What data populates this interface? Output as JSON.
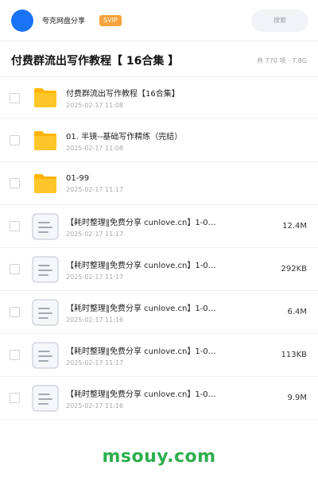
{
  "header": {
    "user_name": "夸克网盘分享",
    "badge": "SVIP",
    "search_placeholder": "搜索"
  },
  "title_bar": {
    "title": "付费群流出写作教程【 16合集 】",
    "summary": "共 770 项 · 7.8G"
  },
  "files": [
    {
      "type": "folder",
      "name": "付费群流出写作教程【16合集】",
      "date": "2025-02-17 11:08",
      "size": ""
    },
    {
      "type": "folder",
      "name": "01. 半镜--基础写作精练（完结）",
      "date": "2025-02-17 11:08",
      "size": ""
    },
    {
      "type": "folder",
      "name": "01-99",
      "date": "2025-02-17 11:17",
      "size": ""
    },
    {
      "type": "doc",
      "name": "【耗时整理‖免费分享 cunlove.cn】1-0…",
      "date": "2025-02-17 11:17",
      "size": "12.4M"
    },
    {
      "type": "doc",
      "name": "【耗时整理‖免费分享 cunlove.cn】1-0…",
      "date": "2025-02-17 11:17",
      "size": "292KB"
    },
    {
      "type": "doc",
      "name": "【耗时整理‖免费分享 cunlove.cn】1-0…",
      "date": "2025-02-17 11:16",
      "size": "6.4M"
    },
    {
      "type": "doc",
      "name": "【耗时整理‖免费分享 cunlove.cn】1-0…",
      "date": "2025-02-17 11:17",
      "size": "113KB"
    },
    {
      "type": "doc",
      "name": "【耗时整理‖免费分享 cunlove.cn】1-0…",
      "date": "2025-02-17 11:16",
      "size": "9.9M"
    }
  ],
  "footer": {
    "watermark": "msouy.com"
  },
  "colors": {
    "accent": "#1a73f5",
    "badge": "#f7a23b",
    "folder": "#ffc629",
    "watermark": "#2eae4e"
  },
  "icons": {
    "folder": "folder-icon",
    "doc": "document-icon"
  }
}
